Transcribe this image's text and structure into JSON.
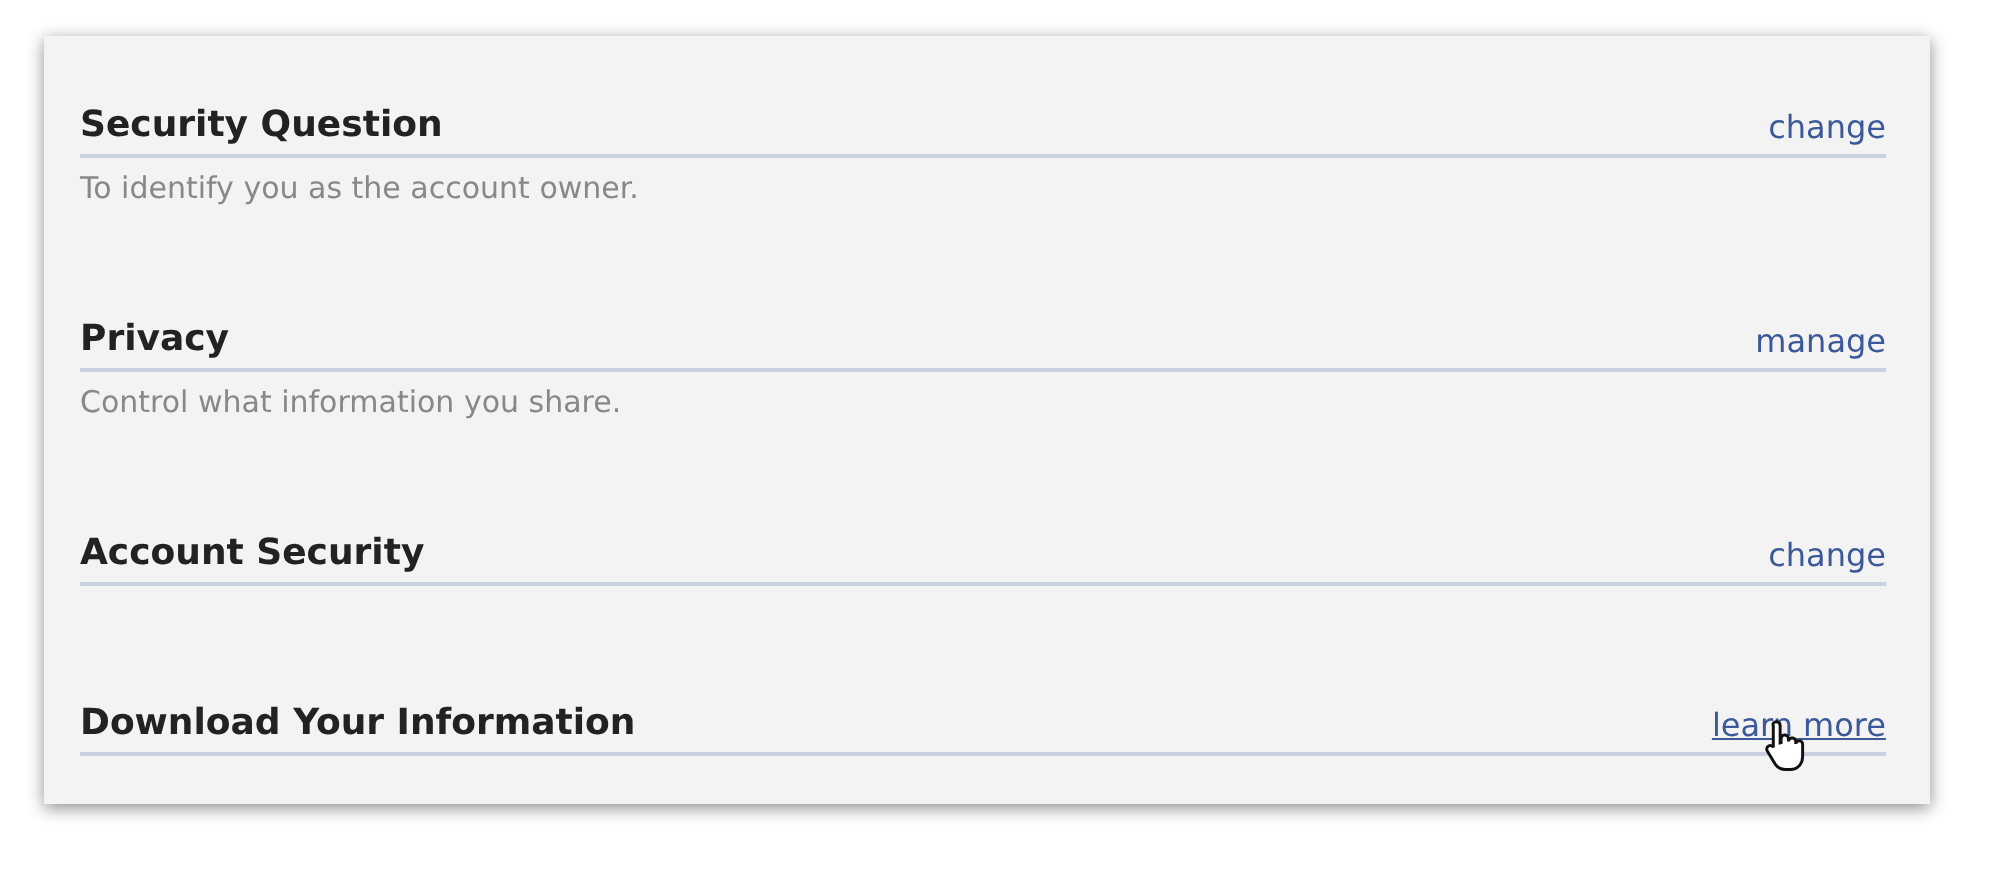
{
  "sections": [
    {
      "title": "Security Question",
      "link": {
        "label": "change",
        "hovered": false
      },
      "description": "To identify you as the account owner."
    },
    {
      "title": "Privacy",
      "link": {
        "label": "manage",
        "hovered": false
      },
      "description": "Control what information you share."
    },
    {
      "title": "Account Security",
      "link": {
        "label": "change",
        "hovered": false
      }
    },
    {
      "title": "Download Your Information",
      "link": {
        "label": "learn more",
        "hovered": true
      }
    }
  ]
}
